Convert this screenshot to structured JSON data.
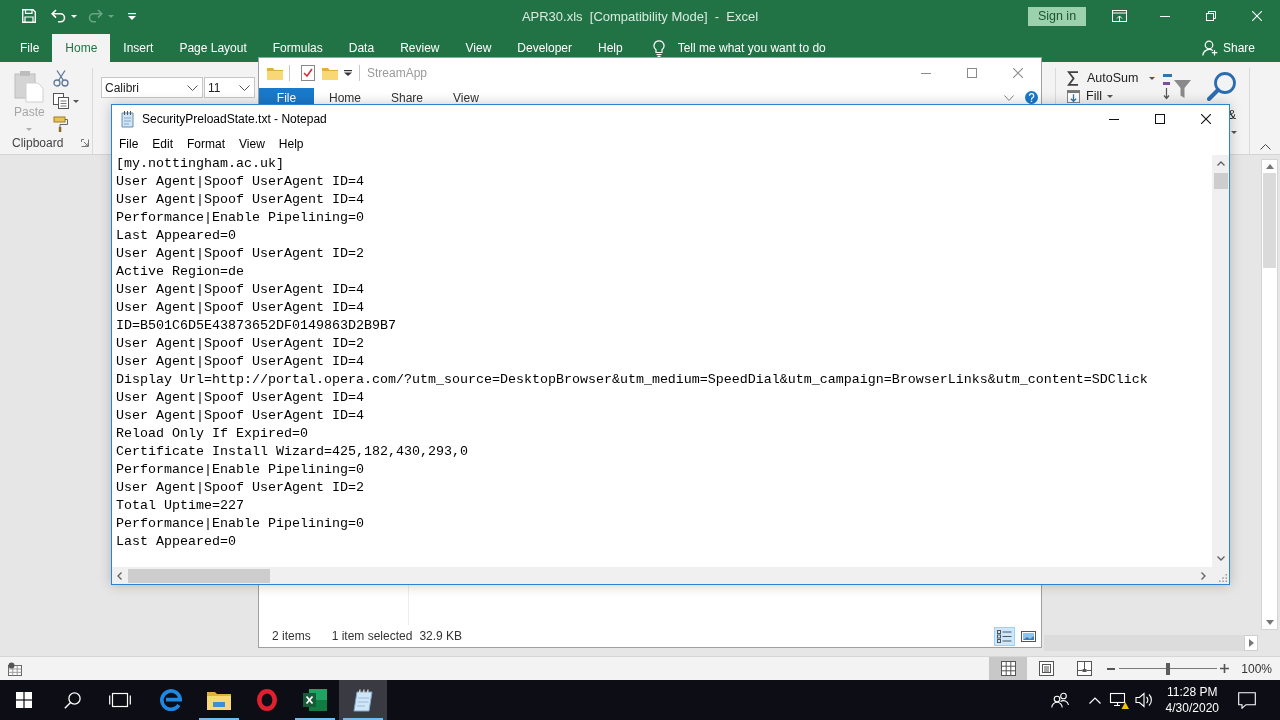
{
  "excel": {
    "quick_access": [
      {
        "kind": "save",
        "disabled": false
      },
      {
        "kind": "undo",
        "disabled": false
      },
      {
        "kind": "redo",
        "disabled": true
      },
      {
        "kind": "customize",
        "disabled": false
      }
    ],
    "title": "APR30.xls  [Compatibility Mode]  -  Excel",
    "sign_in": "Sign in",
    "tabs": [
      {
        "label": "File",
        "selected": false
      },
      {
        "label": "Home",
        "selected": true
      },
      {
        "label": "Insert",
        "selected": false
      },
      {
        "label": "Page Layout",
        "selected": false
      },
      {
        "label": "Formulas",
        "selected": false
      },
      {
        "label": "Data",
        "selected": false
      },
      {
        "label": "Review",
        "selected": false
      },
      {
        "label": "View",
        "selected": false
      },
      {
        "label": "Developer",
        "selected": false
      },
      {
        "label": "Help",
        "selected": false
      }
    ],
    "tell_me": "Tell me what you want to do",
    "share": "Share",
    "ribbon": {
      "paste": {
        "label": "Paste",
        "disabled": true
      },
      "clipboard_group": "Clipboard",
      "font_name": "Calibri",
      "font_size": "11",
      "autosum": "AutoSum",
      "fill": "Fill",
      "find_select": "&"
    },
    "status_bar": {
      "views": [
        {
          "kind": "normal",
          "selected": true
        },
        {
          "kind": "page_layout",
          "selected": false
        },
        {
          "kind": "page_break",
          "selected": false
        }
      ],
      "zoom_slider": {
        "level": 0.5
      },
      "zoom": "100%"
    }
  },
  "explorer": {
    "title": "StreamApp",
    "tabs": [
      {
        "label": "File",
        "kind": "menu"
      },
      {
        "label": "Home",
        "kind": "tab"
      },
      {
        "label": "Share",
        "kind": "tab"
      },
      {
        "label": "View",
        "kind": "tab"
      }
    ],
    "status": {
      "items": "2 items",
      "selection": "1 item selected",
      "size": "32.9 KB"
    },
    "views": [
      {
        "kind": "details",
        "selected": true
      },
      {
        "kind": "large_icons",
        "selected": false
      }
    ]
  },
  "notepad": {
    "title": "SecurityPreloadState.txt - Notepad",
    "menu": [
      "File",
      "Edit",
      "Format",
      "View",
      "Help"
    ],
    "lines": [
      "[my.nottingham.ac.uk]",
      "User Agent|Spoof UserAgent ID=4",
      "User Agent|Spoof UserAgent ID=4",
      "Performance|Enable Pipelining=0",
      "Last Appeared=0",
      "User Agent|Spoof UserAgent ID=2",
      "Active Region=de",
      "User Agent|Spoof UserAgent ID=4",
      "User Agent|Spoof UserAgent ID=4",
      "ID=B501C6D5E43873652DF0149863D2B9B7",
      "User Agent|Spoof UserAgent ID=2",
      "User Agent|Spoof UserAgent ID=4",
      "Display Url=http://portal.opera.com/?utm_source=DesktopBrowser&utm_medium=SpeedDial&utm_campaign=BrowserLinks&utm_content=SDClick",
      "User Agent|Spoof UserAgent ID=4",
      "User Agent|Spoof UserAgent ID=4",
      "Reload Only If Expired=0",
      "Certificate Install Wizard=425,182,430,293,0",
      "Performance|Enable Pipelining=0",
      "User Agent|Spoof UserAgent ID=2",
      "Total Uptime=227",
      "Performance|Enable Pipelining=0",
      "Last Appeared=0"
    ]
  },
  "taskbar": {
    "apps": [
      {
        "kind": "edge",
        "running": false,
        "active": false
      },
      {
        "kind": "explorer",
        "running": true,
        "active": false
      },
      {
        "kind": "opera",
        "running": false,
        "active": false
      },
      {
        "kind": "excel",
        "running": true,
        "active": false
      },
      {
        "kind": "notepad",
        "running": true,
        "active": true
      }
    ],
    "clock": {
      "time": "11:28 PM",
      "date": "4/30/2020"
    }
  }
}
